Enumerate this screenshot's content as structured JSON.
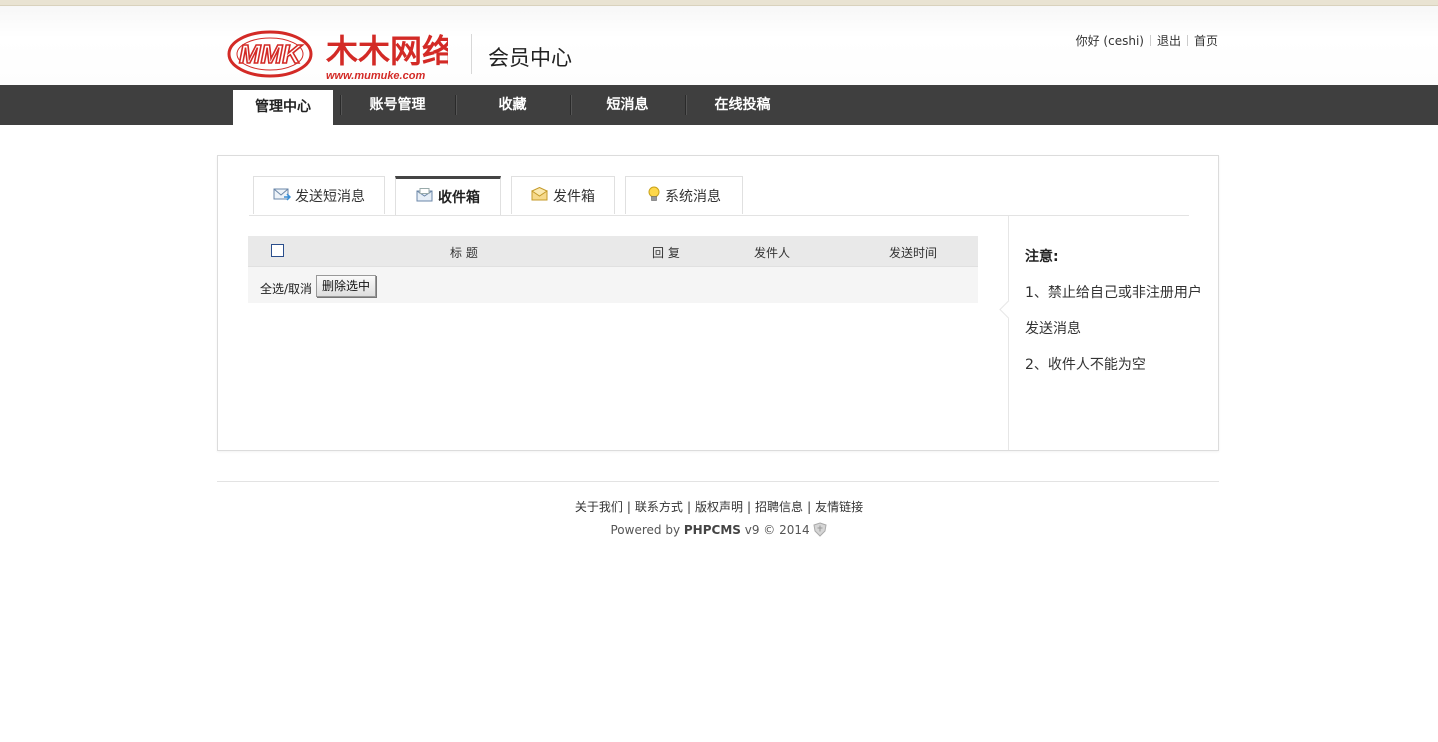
{
  "header": {
    "logo_text": "MMK 木木网络 www.mumuke.com",
    "title": "会员中心",
    "greeting": "你好 (ceshi)",
    "logout": "退出",
    "home": "首页"
  },
  "nav": {
    "items": [
      "管理中心",
      "账号管理",
      "收藏",
      "短消息",
      "在线投稿"
    ],
    "active": "管理中心"
  },
  "tabs": [
    {
      "label": "发送短消息",
      "icon": "mail-send-icon"
    },
    {
      "label": "收件箱",
      "icon": "inbox-icon",
      "active": true
    },
    {
      "label": "发件箱",
      "icon": "outbox-icon"
    },
    {
      "label": "系统消息",
      "icon": "lightbulb-icon"
    }
  ],
  "table": {
    "headers": {
      "title": "标 题",
      "reply": "回 复",
      "sender": "发件人",
      "time": "发送时间"
    },
    "select_all": "全选/取消",
    "delete_button": "删除选中"
  },
  "notes": {
    "title": "注意:",
    "line1": "1、禁止给自己或非注册用户",
    "line2": "发送消息",
    "line3": "2、收件人不能为空"
  },
  "footer": {
    "links": [
      "关于我们",
      "联系方式",
      "版权声明",
      "招聘信息",
      "友情链接"
    ],
    "powered_prefix": "Powered by",
    "powered_brand": "PHPCMS",
    "powered_suffix": "v9 © 2014"
  },
  "colors": {
    "nav_bg": "#3f3f3f",
    "logo_red": "#d32a26"
  }
}
